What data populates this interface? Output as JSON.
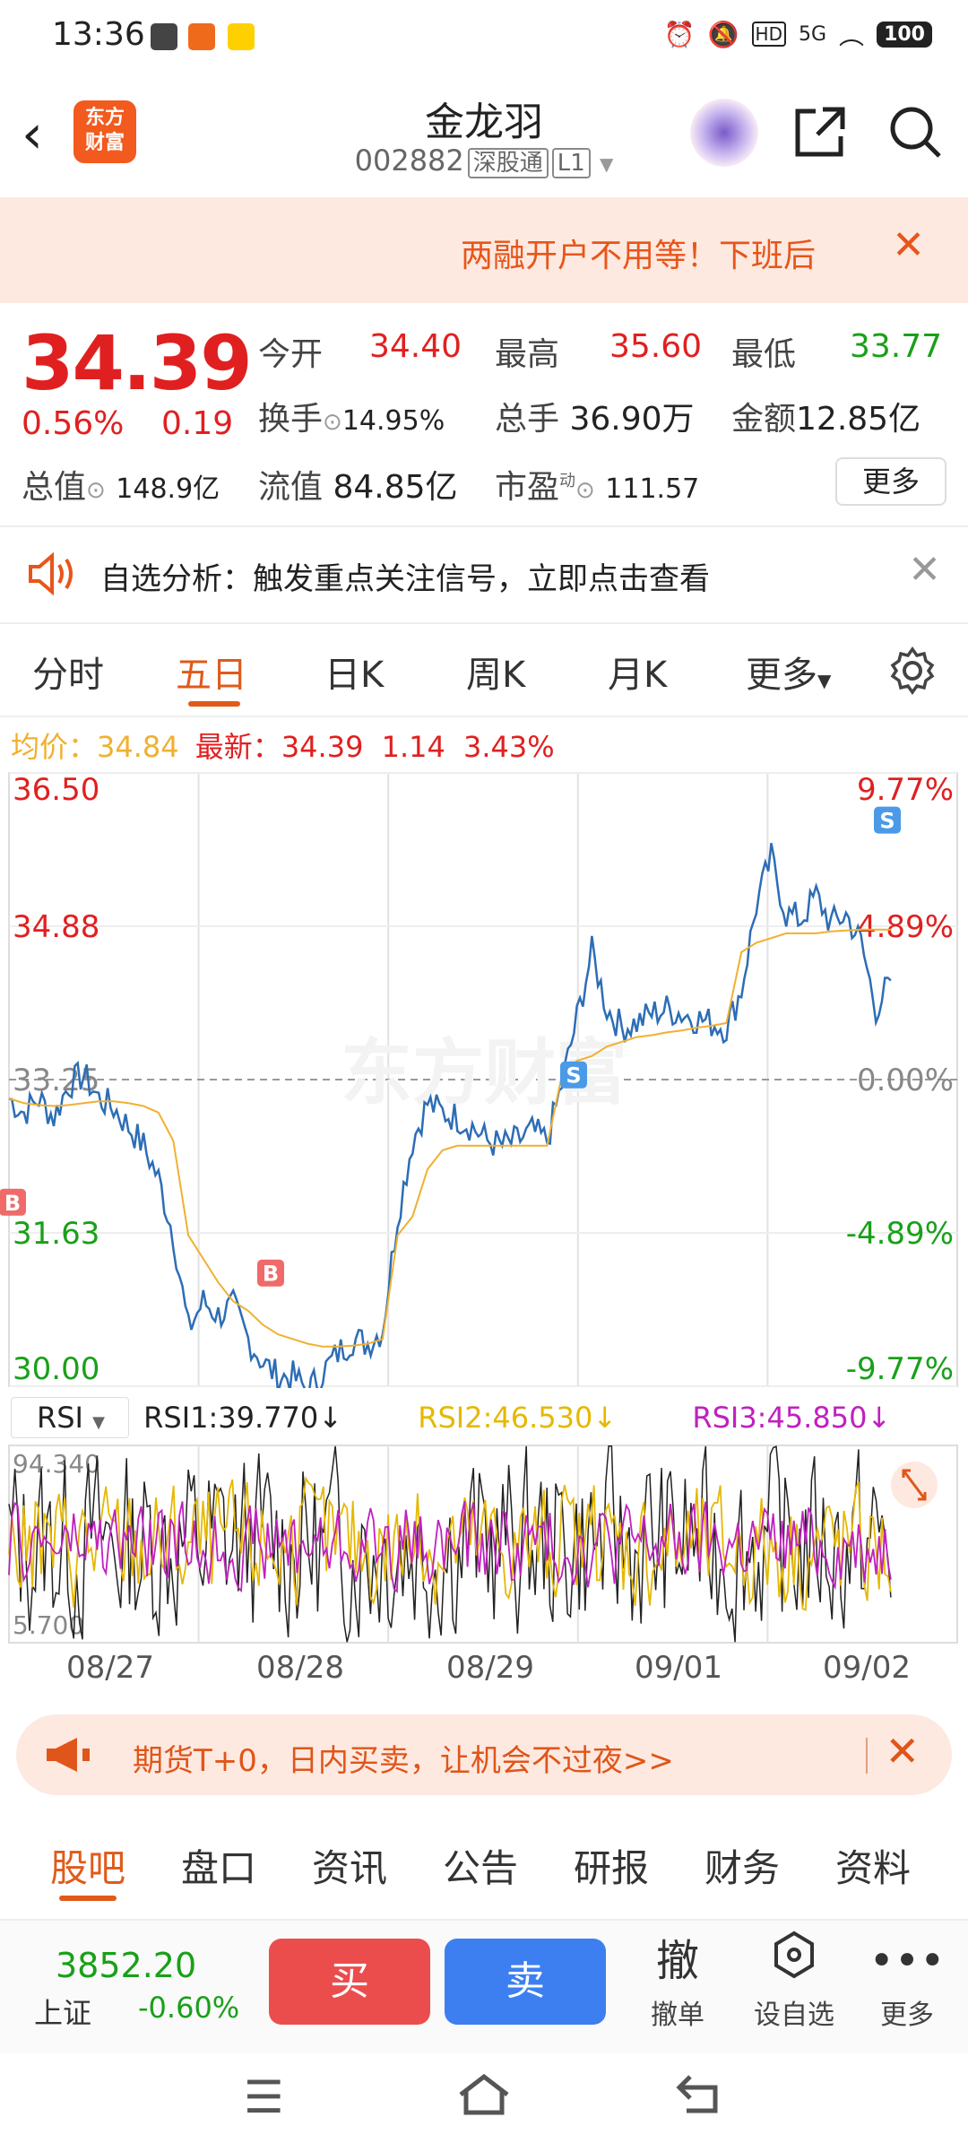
{
  "status_bar": {
    "time": "13:36",
    "battery": "100",
    "signal": "5G"
  },
  "header": {
    "title": "金龙羽",
    "code": "002882",
    "tag1": "深股通",
    "tag2": "L1",
    "logo": "东方\n财富"
  },
  "promo_banner": {
    "text": "两融开户不用等！下班后"
  },
  "quote": {
    "price": "34.39",
    "change_pct": "0.56%",
    "change": "0.19",
    "open_label": "今开",
    "open": "34.40",
    "high_label": "最高",
    "high": "35.60",
    "low_label": "最低",
    "low": "33.77",
    "turnover_label": "换手",
    "turnover": "14.95%",
    "volume_label": "总手",
    "volume": "36.90万",
    "amount_label": "金额",
    "amount": "12.85亿",
    "mcap_label": "总值",
    "mcap": "148.9亿",
    "float_label": "流值",
    "float": "84.85亿",
    "pe_label": "市盈",
    "pe_sup": "动",
    "pe": "111.57",
    "more": "更多"
  },
  "alert": {
    "text": "自选分析：触发重点关注信号，立即点击查看"
  },
  "tabs": [
    "分时",
    "五日",
    "日K",
    "周K",
    "月K",
    "更多"
  ],
  "active_tab": "五日",
  "chart_legend": {
    "avg_label": "均价：",
    "avg": "34.84",
    "latest_label": "最新：",
    "latest": "34.39",
    "chg": "1.14",
    "chg_pct": "3.43%"
  },
  "chart_data": {
    "type": "line",
    "title": "",
    "y_ticks_left": [
      "36.50",
      "34.88",
      "33.25",
      "31.63",
      "30.00"
    ],
    "y_ticks_right": [
      "9.77%",
      "4.89%",
      "0.00%",
      "-4.89%",
      "-9.77%"
    ],
    "ylim": [
      30.0,
      36.5
    ],
    "prev_close": 33.25,
    "dates": [
      "08/27",
      "08/28",
      "08/29",
      "09/01",
      "09/02"
    ],
    "series": [
      {
        "values": [
          33.05,
          32.9,
          33.05,
          32.85,
          33.2,
          33.3,
          33.05,
          32.95,
          32.75,
          32.55,
          32.2,
          31.6,
          30.6,
          30.9,
          30.75,
          30.85,
          30.5,
          30.25,
          30.1,
          30.1,
          29.95,
          30.15,
          30.35,
          30.5,
          30.45,
          30.6,
          31.8,
          32.6,
          33.0,
          32.9,
          32.85,
          32.75,
          32.6,
          32.55,
          32.6,
          32.7,
          32.6,
          33.2,
          33.9,
          34.6,
          34.0,
          33.8,
          33.85,
          33.95,
          34.0,
          33.95,
          33.9,
          33.85,
          33.8,
          34.2,
          35.1,
          35.6,
          35.0,
          34.95,
          35.2,
          34.9,
          35.0,
          34.7,
          34.0,
          34.3
        ]
      },
      {
        "values": [
          33.05,
          33.0,
          32.98,
          32.97,
          32.98,
          33.0,
          33.02,
          33.02,
          33.0,
          32.97,
          32.9,
          32.6,
          31.6,
          31.35,
          31.1,
          30.9,
          30.8,
          30.65,
          30.55,
          30.5,
          30.45,
          30.42,
          30.42,
          30.43,
          30.45,
          30.5,
          31.6,
          31.8,
          32.3,
          32.5,
          32.55,
          32.55,
          32.55,
          32.55,
          32.55,
          32.55,
          32.55,
          33.3,
          33.45,
          33.5,
          33.6,
          33.65,
          33.7,
          33.72,
          33.75,
          33.77,
          33.8,
          33.82,
          33.85,
          34.6,
          34.7,
          34.75,
          34.8,
          34.8,
          34.8,
          34.82,
          34.83,
          34.84,
          34.84,
          34.84
        ]
      }
    ],
    "markers": [
      {
        "label": "B",
        "day": 0
      },
      {
        "label": "B",
        "day": 1
      },
      {
        "label": "S",
        "day": 3
      },
      {
        "label": "S",
        "day": 4
      }
    ],
    "watermark": "东方财富"
  },
  "rsi": {
    "selector": "RSI",
    "rsi1": "RSI1:39.770↓",
    "rsi2": "RSI2:46.530↓",
    "rsi3": "RSI3:45.850↓",
    "max": "94.340",
    "min": "5.700"
  },
  "promo2": {
    "text": "期货T+0，日内买卖，让机会不过夜>>"
  },
  "bottom_tabs": [
    "股吧",
    "盘口",
    "资讯",
    "公告",
    "研报",
    "财务",
    "资料"
  ],
  "index": {
    "value": "3852.20",
    "name": "上证",
    "change": "-0.60%"
  },
  "actions": {
    "buy": "买",
    "sell": "卖",
    "cancel_icon": "撤",
    "cancel": "撤单",
    "watch": "设自选",
    "more": "更多"
  },
  "colors": {
    "up": "#e02020",
    "down": "#19a019",
    "price_line": "#2d6db5",
    "avg_line": "#f0b030",
    "accent": "#e05a1a"
  }
}
